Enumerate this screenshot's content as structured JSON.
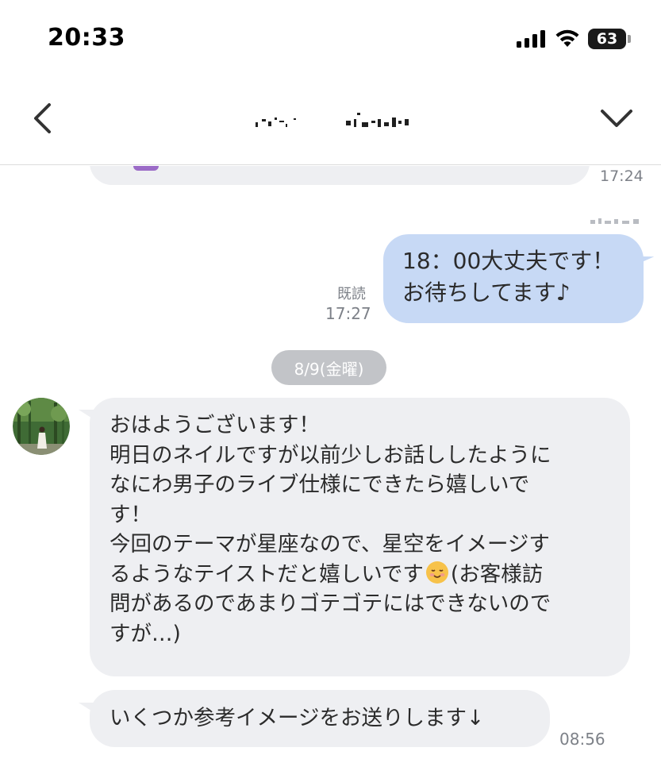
{
  "status_bar": {
    "time": "20:33",
    "battery_level": "63",
    "icons": [
      "cellular-signal-icon",
      "wifi-icon",
      "battery-icon"
    ]
  },
  "nav": {
    "icons": [
      "back-chevron-icon",
      "dropdown-chevron-icon"
    ]
  },
  "messages": [
    {
      "id": "prev-incoming",
      "direction": "incoming",
      "time": "17:24"
    },
    {
      "id": "outgoing-1",
      "direction": "outgoing",
      "lines": [
        "18：00大丈夫です！",
        "お待ちしてます♪"
      ],
      "read_label": "既読",
      "time": "17:27"
    },
    {
      "id": "date-separator",
      "label": "8/9(金曜)"
    },
    {
      "id": "incoming-1",
      "direction": "incoming",
      "lines": [
        "おはようございます！",
        "明日のネイルですが以前少しお話ししたように",
        "なにわ男子のライブ仕様にできたら嬉しいで",
        "す！",
        "今回のテーマが星座なので、星空をイメージす",
        "るようなテイストだと嬉しいです",
        "(お客様訪",
        "問があるのであまりゴテゴテにはできないので",
        "すが…)"
      ]
    },
    {
      "id": "incoming-2",
      "direction": "incoming",
      "text": "いくつか参考イメージをお送りします↓",
      "time": "08:56"
    }
  ],
  "colors": {
    "outgoing_bubble": "#c7d9f5",
    "incoming_bubble": "#eeeff2",
    "date_pill": "#c2c4c8",
    "timestamp": "#7d8188"
  }
}
